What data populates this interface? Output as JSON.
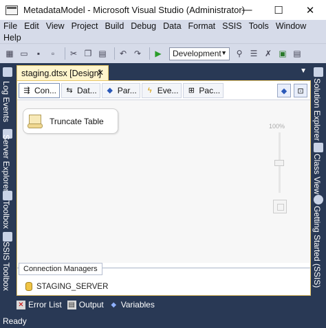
{
  "window": {
    "title": "MetadataModel - Microsoft Visual Studio (Administrator)",
    "minimize_glyph": "—",
    "maximize_glyph": "☐",
    "close_glyph": "✕"
  },
  "menu": {
    "row1": [
      "File",
      "Edit",
      "View",
      "Project",
      "Build",
      "Debug",
      "Data",
      "Format",
      "SSIS",
      "Tools",
      "Window"
    ],
    "row2": [
      "Help"
    ]
  },
  "toolbar": {
    "configuration": "Development"
  },
  "left_rail": {
    "tabs": [
      "Log Events",
      "Server Explorer",
      "Toolbox",
      "SSIS Toolbox"
    ]
  },
  "right_rail": {
    "tabs": [
      "Solution Explorer",
      "Class View",
      "Getting Started (SSIS)"
    ]
  },
  "document": {
    "tab_label": "staging.dtsx [Design]",
    "designer_tabs": [
      "Con...",
      "Dat...",
      "Par...",
      "Eve...",
      "Pac..."
    ]
  },
  "canvas": {
    "task_label": "Truncate Table",
    "zoom_pct": "100%"
  },
  "connection_managers": {
    "tab_label": "Connection Managers",
    "items": [
      "STAGING_SERVER"
    ]
  },
  "bottom_tabs": [
    "Error List",
    "Output",
    "Variables"
  ],
  "status": {
    "text": "Ready"
  },
  "colors": {
    "chrome": "#293955",
    "menu_bg": "#d6dbe9",
    "doc_tab": "#fff5cc",
    "accent_border": "#e5c365"
  }
}
